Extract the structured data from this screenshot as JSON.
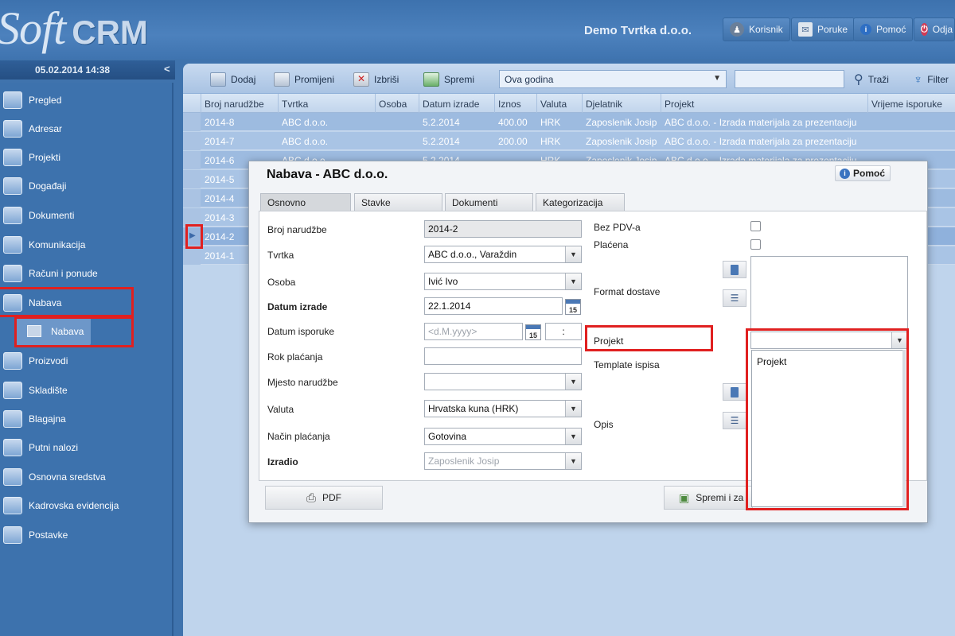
{
  "header": {
    "logo_soft": "Soft",
    "logo_crm": "CRM",
    "company": "Demo Tvrtka d.o.o.",
    "buttons": [
      {
        "label": "Korisnik",
        "icon": "user-icon"
      },
      {
        "label": "Poruke",
        "icon": "message-icon"
      },
      {
        "label": "Pomoć",
        "icon": "help-icon"
      },
      {
        "label": "Odja",
        "icon": "power-icon"
      }
    ]
  },
  "datebar": {
    "datetime": "05.02.2014 14:38",
    "collapse": "<"
  },
  "sidebar": {
    "items": [
      {
        "label": "Pregled",
        "icon": "overview-icon"
      },
      {
        "label": "Adresar",
        "icon": "address-book-icon"
      },
      {
        "label": "Projekti",
        "icon": "projects-icon"
      },
      {
        "label": "Događaji",
        "icon": "calendar-icon"
      },
      {
        "label": "Dokumenti",
        "icon": "documents-icon"
      },
      {
        "label": "Komunikacija",
        "icon": "communication-icon"
      },
      {
        "label": "Računi i ponude",
        "icon": "invoice-icon"
      },
      {
        "label": "Nabava",
        "icon": "procurement-icon"
      },
      {
        "label": "Proizvodi",
        "icon": "products-icon"
      },
      {
        "label": "Skladište",
        "icon": "warehouse-icon"
      },
      {
        "label": "Blagajna",
        "icon": "cash-register-icon"
      },
      {
        "label": "Putni nalozi",
        "icon": "travel-order-icon"
      },
      {
        "label": "Osnovna sredstva",
        "icon": "assets-icon"
      },
      {
        "label": "Kadrovska evidencija",
        "icon": "hr-icon"
      },
      {
        "label": "Postavke",
        "icon": "settings-icon"
      }
    ],
    "subitem": "Nabava"
  },
  "toolbar": {
    "add": "Dodaj",
    "edit": "Promijeni",
    "delete": "Izbriši",
    "save": "Spremi",
    "period": "Ova godina",
    "search": "Traži",
    "filter": "Filter"
  },
  "grid": {
    "columns": [
      "Broj narudžbe",
      "Tvrtka",
      "Osoba",
      "Datum izrade",
      "Iznos",
      "Valuta",
      "Djelatnik",
      "Projekt",
      "Vrijeme isporuke"
    ],
    "rows": [
      [
        "2014-8",
        "ABC d.o.o.",
        "",
        "5.2.2014",
        "400.00",
        "HRK",
        "Zaposlenik Josip",
        "ABC d.o.o. - Izrada materijala za prezentaciju",
        ""
      ],
      [
        "2014-7",
        "ABC d.o.o.",
        "",
        "5.2.2014",
        "200.00",
        "HRK",
        "Zaposlenik Josip",
        "ABC d.o.o. - Izrada materijala za prezentaciju",
        ""
      ],
      [
        "2014-6",
        "ABC d.o.o.",
        "",
        "5.2.2014",
        "",
        "HRK",
        "Zaposlenik Josip",
        "ABC d.o.o. - Izrada materijala za prezentaciju",
        ""
      ],
      [
        "2014-5",
        "",
        "",
        "",
        "",
        "",
        "",
        "",
        ""
      ],
      [
        "2014-4",
        "",
        "",
        "",
        "",
        "",
        "",
        "",
        ""
      ],
      [
        "2014-3",
        "",
        "",
        "",
        "",
        "",
        "",
        "",
        ""
      ],
      [
        "2014-2",
        "",
        "",
        "",
        "",
        "",
        "",
        "",
        ""
      ],
      [
        "2014-1",
        "",
        "",
        "",
        "",
        "",
        "",
        "",
        ""
      ]
    ]
  },
  "dialog": {
    "title": "Nabava - ABC d.o.o.",
    "help": "Pomoć",
    "tabs": [
      "Osnovno",
      "Stavke",
      "Dokumenti",
      "Kategorizacija"
    ],
    "fields": {
      "order_no_label": "Broj narudžbe",
      "order_no": "2014-2",
      "company_label": "Tvrtka",
      "company": "ABC d.o.o., Varaždin",
      "person_label": "Osoba",
      "person": "Ivić Ivo",
      "created_label": "Datum izrade",
      "created": "22.1.2014",
      "delivery_label": "Datum isporuke",
      "delivery_placeholder": "<d.M.yyyy>",
      "delivery_time": ":",
      "payment_term_label": "Rok plaćanja",
      "payment_term": "",
      "order_place_label": "Mjesto narudžbe",
      "order_place": "",
      "currency_label": "Valuta",
      "currency": "Hrvatska kuna (HRK)",
      "payment_method_label": "Način plaćanja",
      "payment_method": "Gotovina",
      "made_by_label": "Izradio",
      "made_by": "Zaposlenik Josip",
      "no_vat_label": "Bez PDV-a",
      "paid_label": "Plaćena",
      "delivery_format_label": "Format dostave",
      "project_label": "Projekt",
      "print_template_label": "Template ispisa",
      "description_label": "Opis"
    },
    "cal_day": "15",
    "project_options": [
      "Projekt"
    ],
    "pdf": "PDF",
    "save_close": "Spremi i za"
  }
}
